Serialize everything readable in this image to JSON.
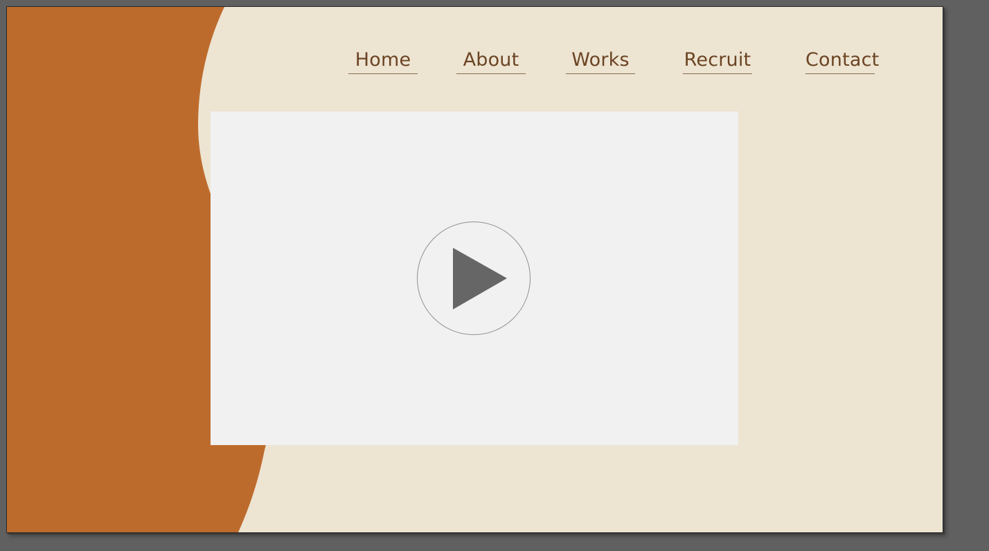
{
  "colors": {
    "background": "#ede4d2",
    "accent": "#bd6b2d",
    "nav_text": "#6b4423",
    "video_placeholder": "#f1f1f1",
    "play_icon": "#666666"
  },
  "nav": {
    "items": [
      {
        "label": "Home"
      },
      {
        "label": "About"
      },
      {
        "label": "Works"
      },
      {
        "label": "Recruit"
      },
      {
        "label": "Contact"
      }
    ]
  },
  "video": {
    "icon": "play-icon"
  }
}
